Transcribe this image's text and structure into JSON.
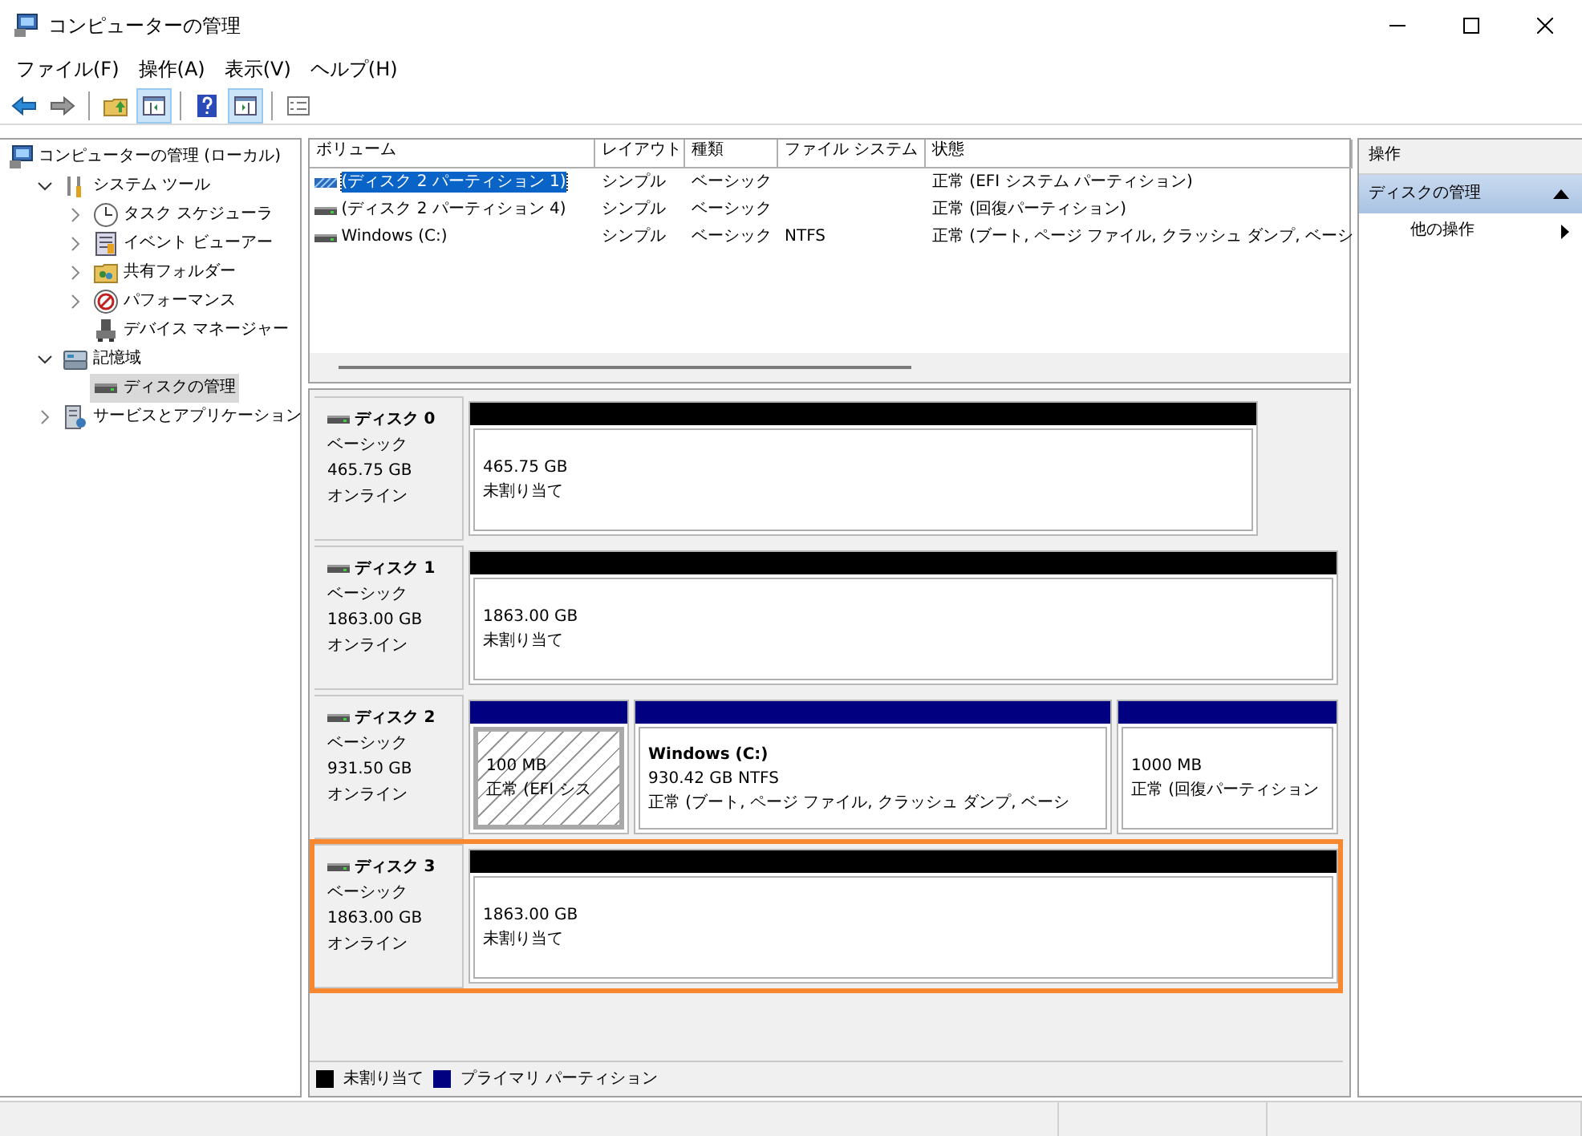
{
  "window": {
    "title": "コンピューターの管理"
  },
  "menu": [
    "ファイル(F)",
    "操作(A)",
    "表示(V)",
    "ヘルプ(H)"
  ],
  "toolbar": [
    {
      "kind": "back",
      "pressed": false
    },
    {
      "kind": "forward",
      "pressed": false
    },
    {
      "kind": "sep"
    },
    {
      "kind": "up",
      "pressed": false
    },
    {
      "kind": "tree",
      "pressed": true
    },
    {
      "kind": "sep"
    },
    {
      "kind": "help",
      "pressed": false
    },
    {
      "kind": "pane",
      "pressed": true
    },
    {
      "kind": "sep"
    },
    {
      "kind": "props",
      "pressed": false
    }
  ],
  "tree": [
    {
      "label": "コンピューターの管理 (ローカル)",
      "kind": "computer",
      "selected": false,
      "children": [
        {
          "label": "システム ツール",
          "kind": "tools",
          "expanded": true,
          "selected": false,
          "children": [
            {
              "label": "タスク スケジューラ",
              "kind": "clock",
              "expanded": false,
              "selected": false
            },
            {
              "label": "イベント ビューアー",
              "kind": "event",
              "expanded": false,
              "selected": false
            },
            {
              "label": "共有フォルダー",
              "kind": "share",
              "expanded": false,
              "selected": false
            },
            {
              "label": "パフォーマンス",
              "kind": "perf",
              "expanded": false,
              "selected": false
            },
            {
              "label": "デバイス マネージャー",
              "kind": "device",
              "selected": false
            }
          ]
        },
        {
          "label": "記憶域",
          "kind": "storage",
          "expanded": true,
          "selected": false,
          "children": [
            {
              "label": "ディスクの管理",
              "kind": "disk",
              "selected": true
            }
          ]
        },
        {
          "label": "サービスとアプリケーション",
          "kind": "services",
          "expanded": false,
          "selected": false
        }
      ]
    }
  ],
  "volumes": {
    "columns": [
      "ボリューム",
      "レイアウト",
      "種類",
      "ファイル システム",
      "状態"
    ],
    "rows": [
      {
        "volume": "(ディスク 2 パーティション 1)",
        "layout": "シンプル",
        "type": "ベーシック",
        "fs": "",
        "status": "正常 (EFI システム パーティション)",
        "selected": true
      },
      {
        "volume": "(ディスク 2 パーティション 4)",
        "layout": "シンプル",
        "type": "ベーシック",
        "fs": "",
        "status": "正常 (回復パーティション)",
        "selected": false
      },
      {
        "volume": "Windows (C:)",
        "layout": "シンプル",
        "type": "ベーシック",
        "fs": "NTFS",
        "status": "正常 (ブート, ページ ファイル, クラッシュ ダンプ, ベーシ",
        "selected": false
      }
    ]
  },
  "disks": [
    {
      "name": "ディスク 0",
      "type": "ベーシック",
      "size": "465.75 GB",
      "status": "オンライン",
      "highlighted": false,
      "partitions": [
        {
          "kind": "unallocated",
          "size": "465.75 GB",
          "status": "未割り当て",
          "selected": false
        }
      ]
    },
    {
      "name": "ディスク 1",
      "type": "ベーシック",
      "size": "1863.00 GB",
      "status": "オンライン",
      "highlighted": false,
      "partitions": [
        {
          "kind": "unallocated",
          "size": "1863.00 GB",
          "status": "未割り当て",
          "selected": false
        }
      ]
    },
    {
      "name": "ディスク 2",
      "type": "ベーシック",
      "size": "931.50 GB",
      "status": "オンライン",
      "highlighted": false,
      "partitions": [
        {
          "kind": "primary",
          "size": "100 MB",
          "status": "正常 (EFI シス",
          "selected": true
        },
        {
          "kind": "primary",
          "name": "Windows  (C:)",
          "size": "930.42 GB NTFS",
          "status": "正常 (ブート, ページ ファイル, クラッシュ ダンプ, ベーシ",
          "selected": false
        },
        {
          "kind": "primary",
          "size": "1000 MB",
          "status": "正常 (回復パーティション",
          "selected": false
        }
      ]
    },
    {
      "name": "ディスク 3",
      "type": "ベーシック",
      "size": "1863.00 GB",
      "status": "オンライン",
      "highlighted": true,
      "partitions": [
        {
          "kind": "unallocated",
          "size": "1863.00 GB",
          "status": "未割り当て",
          "selected": false
        }
      ]
    }
  ],
  "legend": [
    {
      "label": "未割り当て",
      "color": "#000000"
    },
    {
      "label": "プライマリ パーティション",
      "color": "#000080"
    }
  ],
  "actions": {
    "title": "操作",
    "section": {
      "label": "ディスクの管理",
      "expanded": true
    },
    "items": [
      {
        "label": "他の操作"
      }
    ]
  }
}
